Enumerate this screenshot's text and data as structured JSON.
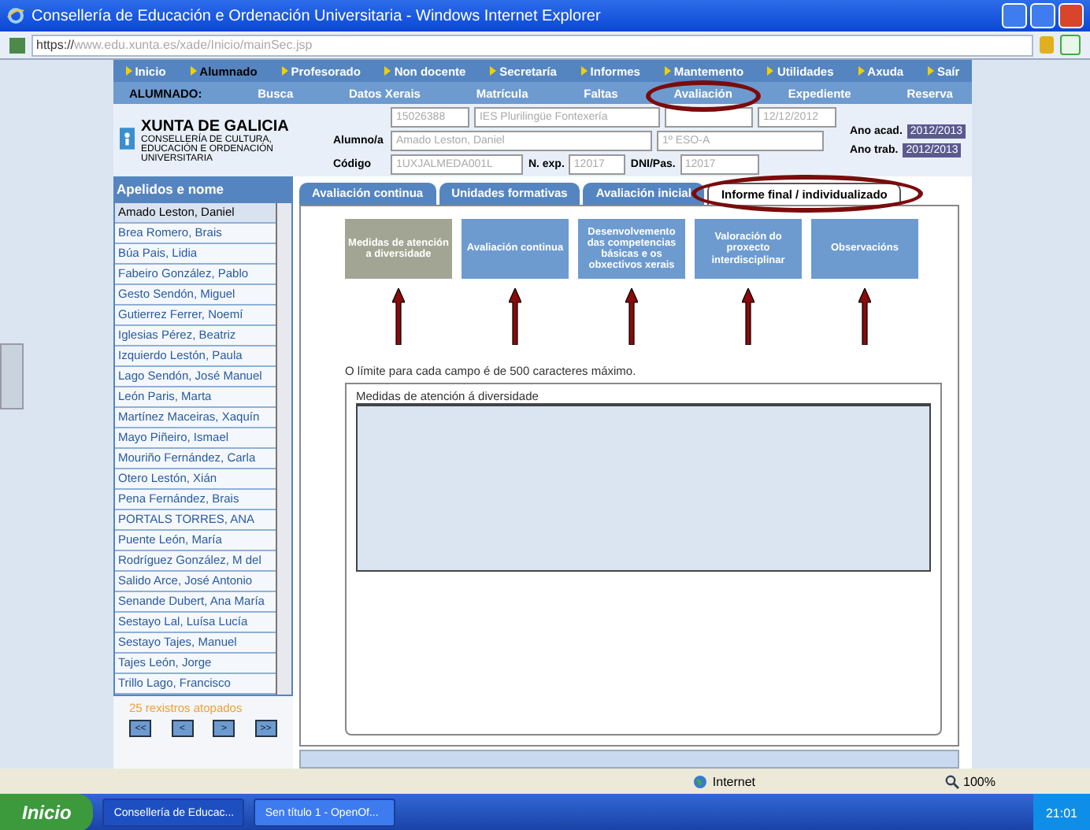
{
  "window": {
    "title": "Consellería de Educación e Ordenación Universitaria   - Windows Internet Explorer",
    "url_scheme": "https://",
    "url_domain": "www.edu.xunta.es/xade/Inicio/mainSec.jsp"
  },
  "menu": [
    {
      "label": "Inicio",
      "selected": false
    },
    {
      "label": "Alumnado",
      "selected": true
    },
    {
      "label": "Profesorado",
      "selected": false
    },
    {
      "label": "Non docente",
      "selected": false
    },
    {
      "label": "Secretaría",
      "selected": false
    },
    {
      "label": "Informes",
      "selected": false
    },
    {
      "label": "Mantemento",
      "selected": false
    },
    {
      "label": "Utilidades",
      "selected": false
    },
    {
      "label": "Axuda",
      "selected": false
    },
    {
      "label": "Saír",
      "selected": false
    }
  ],
  "submenu": {
    "heading": "ALUMNADO:",
    "items": [
      {
        "label": "Busca",
        "circled": false
      },
      {
        "label": "Datos Xerais",
        "circled": false
      },
      {
        "label": "Matrícula",
        "circled": false
      },
      {
        "label": "Faltas",
        "circled": false
      },
      {
        "label": "Avaliación",
        "circled": true
      },
      {
        "label": "Expediente",
        "circled": false
      },
      {
        "label": "Reserva",
        "circled": false
      }
    ]
  },
  "header": {
    "logo_title": "XUNTA DE GALICIA",
    "logo_subtitle": "CONSELLERÍA DE CULTURA, EDUCACIÓN E ORDENACIÓN UNIVERSITARIA",
    "center_code": "15026388",
    "center_name": "IES Plurilingüe Fontexería",
    "date": "12/12/2012",
    "student_label": "Alumno/a",
    "student": "Amado Leston, Daniel",
    "group": "1º ESO-A",
    "code_label": "Código",
    "code": "1UXJALMEDA001L",
    "exp_label": "N. exp.",
    "exp": "12017",
    "dni_label": "DNI/Pas.",
    "dni": "12017",
    "acad_label": "Ano acad.",
    "acad": "2012/2013",
    "trab_label": "Ano trab.",
    "trab": "2012/2013"
  },
  "students": {
    "heading": "Apelidos e nome",
    "count_text": "25 rexistros atopados",
    "pager": [
      "<<",
      "<",
      ">",
      ">>"
    ],
    "items": [
      {
        "name": "Amado Leston, Daniel",
        "selected": true
      },
      {
        "name": "Brea Romero, Brais",
        "selected": false
      },
      {
        "name": "Búa Pais, Lidia",
        "selected": false
      },
      {
        "name": "Fabeiro González, Pablo",
        "selected": false
      },
      {
        "name": "Gesto Sendón, Miguel",
        "selected": false
      },
      {
        "name": "Gutierrez Ferrer, Noemí",
        "selected": false
      },
      {
        "name": "Iglesias Pérez, Beatriz",
        "selected": false
      },
      {
        "name": "Izquierdo Lestón, Paula",
        "selected": false
      },
      {
        "name": "Lago Sendón, José Manuel",
        "selected": false
      },
      {
        "name": "León Paris, Marta",
        "selected": false
      },
      {
        "name": "Martínez Maceiras, Xaquín",
        "selected": false
      },
      {
        "name": "Mayo Piñeiro, Ismael",
        "selected": false
      },
      {
        "name": "Mouriño Fernández, Carla",
        "selected": false
      },
      {
        "name": "Otero Lestón, Xián",
        "selected": false
      },
      {
        "name": "Pena Fernández, Brais",
        "selected": false
      },
      {
        "name": "PORTALS TORRES, ANA",
        "selected": false
      },
      {
        "name": "Puente León, María",
        "selected": false
      },
      {
        "name": "Rodríguez González, M del",
        "selected": false
      },
      {
        "name": "Salido Arce, José Antonio",
        "selected": false
      },
      {
        "name": "Senande Dubert, Ana María",
        "selected": false
      },
      {
        "name": "Sestayo Lal, Luísa Lucía",
        "selected": false
      },
      {
        "name": "Sestayo Tajes, Manuel",
        "selected": false
      },
      {
        "name": "Tajes León, Jorge",
        "selected": false
      },
      {
        "name": "Trillo Lago, Francisco",
        "selected": false
      }
    ]
  },
  "tabs": [
    {
      "label": "Avaliación continua",
      "selected": false,
      "circled": false
    },
    {
      "label": "Unidades formativas",
      "selected": false,
      "circled": false
    },
    {
      "label": "Avaliación inicial",
      "selected": false,
      "circled": false
    },
    {
      "label": "Informe final / individualizado",
      "selected": true,
      "circled": true
    }
  ],
  "sections": [
    {
      "label": "Medidas de atención a diversidade",
      "selected": true
    },
    {
      "label": "Avaliación continua",
      "selected": false
    },
    {
      "label": "Desenvolvemento das competencias básicas e os obxectivos xerais",
      "selected": false
    },
    {
      "label": "Valoración do proxecto interdisciplinar",
      "selected": false
    },
    {
      "label": "Observacións",
      "selected": false
    }
  ],
  "limit_note": "O límite para cada campo é de 500 caracteres máximo.",
  "field": {
    "label": "Medidas de atención á diversidade"
  },
  "status_bar": {
    "zone": "Internet",
    "zoom": "100%"
  },
  "taskbar": {
    "start": "Inicio",
    "tasks": [
      {
        "label": "Consellería de Educac...",
        "selected": true
      },
      {
        "label": "Sen título 1 - OpenOf...",
        "selected": false
      }
    ],
    "clock": "21:01"
  }
}
